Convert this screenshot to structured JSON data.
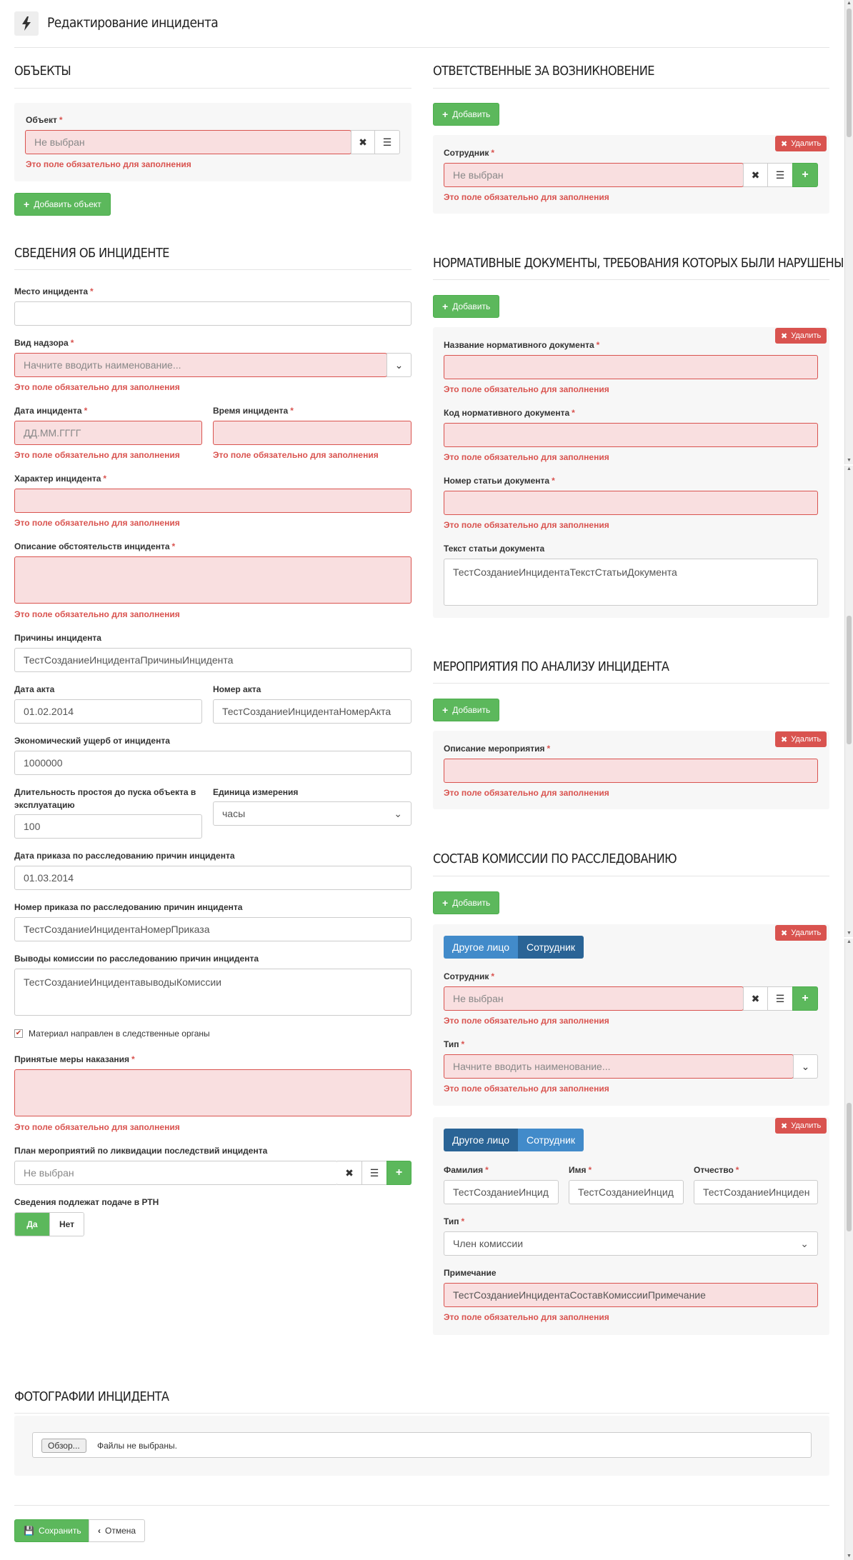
{
  "header": {
    "title": "Редактирование инцидента",
    "icon": "bolt-icon"
  },
  "objects": {
    "title": "ОБЪЕКТЫ",
    "label": "Объект",
    "placeholder": "Не выбран",
    "error": "Это поле обязательно для заполнения",
    "add": "Добавить объект"
  },
  "info": {
    "title": "СВЕДЕНИЯ ОБ ИНЦИДЕНТЕ",
    "place_label": "Место инцидента",
    "supervision_label": "Вид надзора",
    "supervision_placeholder": "Начните вводить наименование...",
    "date_label": "Дата инцидента",
    "date_placeholder": "ДД.ММ.ГГГГ",
    "time_label": "Время инцидента",
    "character_label": "Характер инцидента",
    "description_label": "Описание обстоятельств инцидента",
    "causes_label": "Причины инцидента",
    "causes_value": "ТестСозданиеИнцидентаПричиныИнцидента",
    "act_date_label": "Дата акта",
    "act_date_value": "01.02.2014",
    "act_number_label": "Номер акта",
    "act_number_value": "ТестСозданиеИнцидентаНомерАкта",
    "damage_label": "Экономический ущерб от инцидента",
    "damage_value": "1000000",
    "downtime_label_1": "Длительность простоя до пуска объекта в",
    "downtime_label_2": "эксплуатацию",
    "downtime_value": "100",
    "unit_label": "Единица измерения",
    "unit_value": "часы",
    "order_date_label": "Дата приказа по расследованию причин инцидента",
    "order_date_value": "01.03.2014",
    "order_number_label": "Номер приказа по расследованию причин инцидента",
    "order_number_value": "ТестСозданиеИнцидентаНомерПриказа",
    "conclusions_label": "Выводы комиссии по расследованию причин инцидента",
    "conclusions_value": "ТестСозданиеИнцидентавыводыКомиссии",
    "material_sent": "Материал направлен в следственные органы",
    "measures_label": "Принятые меры наказания",
    "plan_label": "План мероприятий по ликвидации последствий инцидента",
    "plan_placeholder": "Не выбран",
    "rtn_label": "Сведения подлежат подаче в РТН",
    "yes": "Да",
    "no": "Нет",
    "error": "Это поле обязательно для заполнения"
  },
  "responsible": {
    "title": "ОТВЕТСТВЕННЫЕ ЗА ВОЗНИКНОВЕНИЕ",
    "add": "Добавить",
    "delete": "Удалить",
    "employee_label": "Сотрудник",
    "employee_placeholder": "Не выбран",
    "error": "Это поле обязательно для заполнения"
  },
  "normative": {
    "title": "НОРМАТИВНЫЕ ДОКУМЕНТЫ, ТРЕБОВАНИЯ КОТОРЫХ БЫЛИ НАРУШЕНЫ",
    "add": "Добавить",
    "delete": "Удалить",
    "name_label": "Название нормативного документа",
    "code_label": "Код нормативного документа",
    "article_label": "Номер статьи документа",
    "text_label": "Текст статьи документа",
    "text_value": "ТестСозданиеИнцидентаТекстСтатьиДокумента",
    "error": "Это поле обязательно для заполнения"
  },
  "analysis": {
    "title": "МЕРОПРИЯТИЯ ПО АНАЛИЗУ ИНЦИДЕНТА",
    "add": "Добавить",
    "delete": "Удалить",
    "desc_label": "Описание мероприятия",
    "error": "Это поле обязательно для заполнения"
  },
  "commission": {
    "title": "СОСТАВ КОМИССИИ ПО РАССЛЕДОВАНИЮ",
    "add": "Добавить",
    "delete": "Удалить",
    "other_person": "Другое лицо",
    "employee": "Сотрудник",
    "employee_label": "Сотрудник",
    "employee_placeholder": "Не выбран",
    "type_label": "Тип",
    "type_placeholder": "Начните вводить наименование...",
    "surname_label": "Фамилия",
    "surname_value": "ТестСозданиеИнцид",
    "name_label": "Имя",
    "name_value": "ТестСозданиеИнцид",
    "patronymic_label": "Отчество",
    "patronymic_value": "ТестСозданиеИнциден",
    "type2_value": "Член комиссии",
    "note_label": "Примечание",
    "note_value": "ТестСозданиеИнцидентаСоставКомиссииПримечание",
    "error": "Это поле обязательно для заполнения"
  },
  "photos": {
    "title": "ФОТОГРАФИИ ИНЦИДЕНТА",
    "browse": "Обзор...",
    "no_files": "Файлы не выбраны."
  },
  "footer": {
    "save": "Сохранить",
    "cancel": "Отмена"
  },
  "colors": {
    "error": "#d9534f",
    "success": "#5cb85c",
    "primary": "#428bca"
  }
}
